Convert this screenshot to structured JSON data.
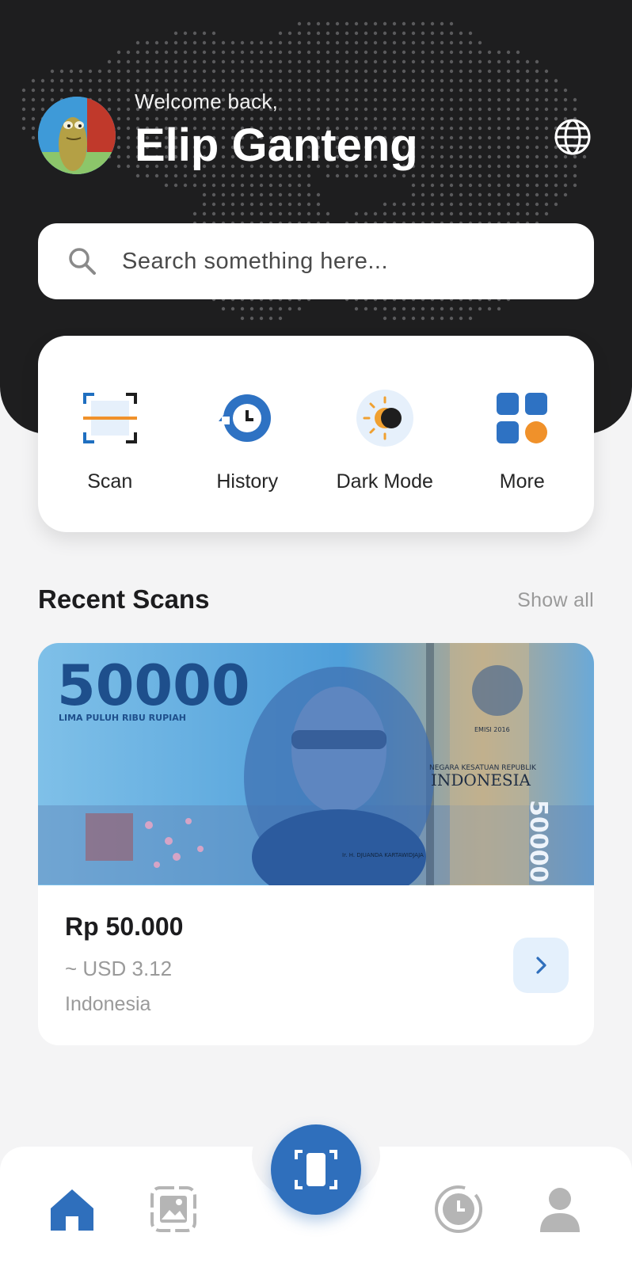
{
  "header": {
    "welcome_text": "Welcome back,",
    "user_name": "Elip Ganteng",
    "background_color": "#1e1e1f",
    "avatar_icon": "cartoon-avatar",
    "language_icon": "globe-icon"
  },
  "search": {
    "placeholder": "Search something here...",
    "value": "",
    "icon": "search-icon"
  },
  "quick_actions": [
    {
      "label": "Scan",
      "icon": "scan-icon"
    },
    {
      "label": "History",
      "icon": "history-icon"
    },
    {
      "label": "Dark Mode",
      "icon": "dark-mode-icon"
    },
    {
      "label": "More",
      "icon": "grid-icon"
    }
  ],
  "recent": {
    "title": "Recent Scans",
    "show_all": "Show all",
    "items": [
      {
        "amount": "Rp 50.000",
        "converted": "~ USD 3.12",
        "country": "Indonesia",
        "image": {
          "denomination": "50000",
          "words": "LIMA PULUH RIBU RUPIAH",
          "country_text": "INDONESIA",
          "republic_text": "NEGARA KESATUAN REPUBLIK",
          "series": "EMISI 2016",
          "portrait_caption": "Ir. H. DJUANDA KARTAWIDJAJA"
        }
      }
    ]
  },
  "bottom_nav": {
    "items": [
      "home-icon",
      "gallery-icon",
      "scan-fab-icon",
      "timer-icon",
      "profile-icon"
    ],
    "active": "home-icon",
    "accent_color": "#2f6fbc",
    "inactive_color": "#b5b5b5"
  }
}
